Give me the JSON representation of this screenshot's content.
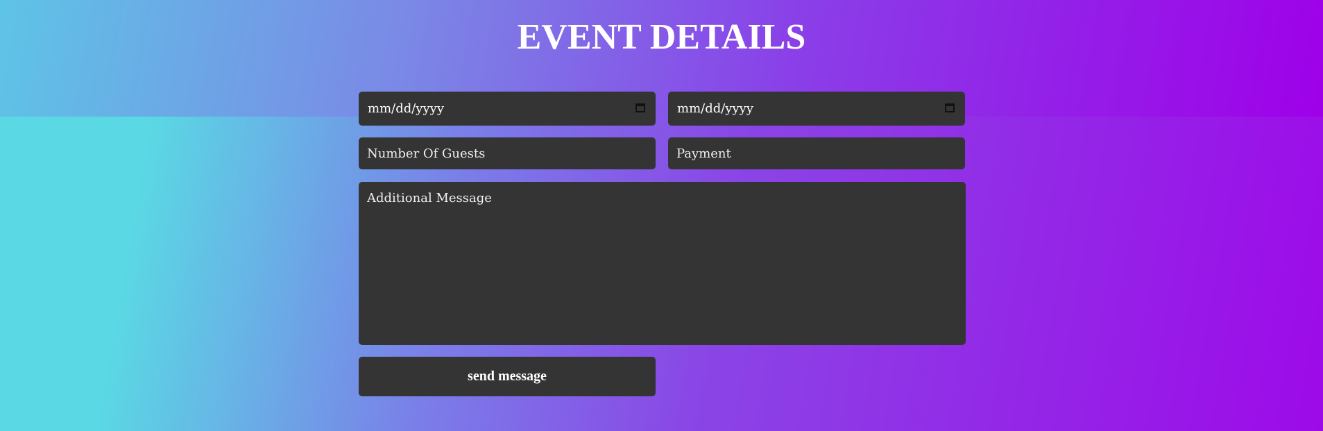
{
  "page": {
    "title": "EVENT DETAILS"
  },
  "form": {
    "start_date": {
      "value": "mm/dd/yyyy",
      "icon": "calendar-icon"
    },
    "end_date": {
      "value": "mm/dd/yyyy",
      "icon": "calendar-icon"
    },
    "guests": {
      "placeholder": "Number Of Guests"
    },
    "payment": {
      "placeholder": "Payment"
    },
    "message": {
      "placeholder": "Additional Message"
    },
    "submit_label": "send message"
  },
  "colors": {
    "field_bg": "#343434",
    "text": "#ffffff",
    "gradient_start": "#5ad9e4",
    "gradient_end": "#9d0ae8"
  }
}
